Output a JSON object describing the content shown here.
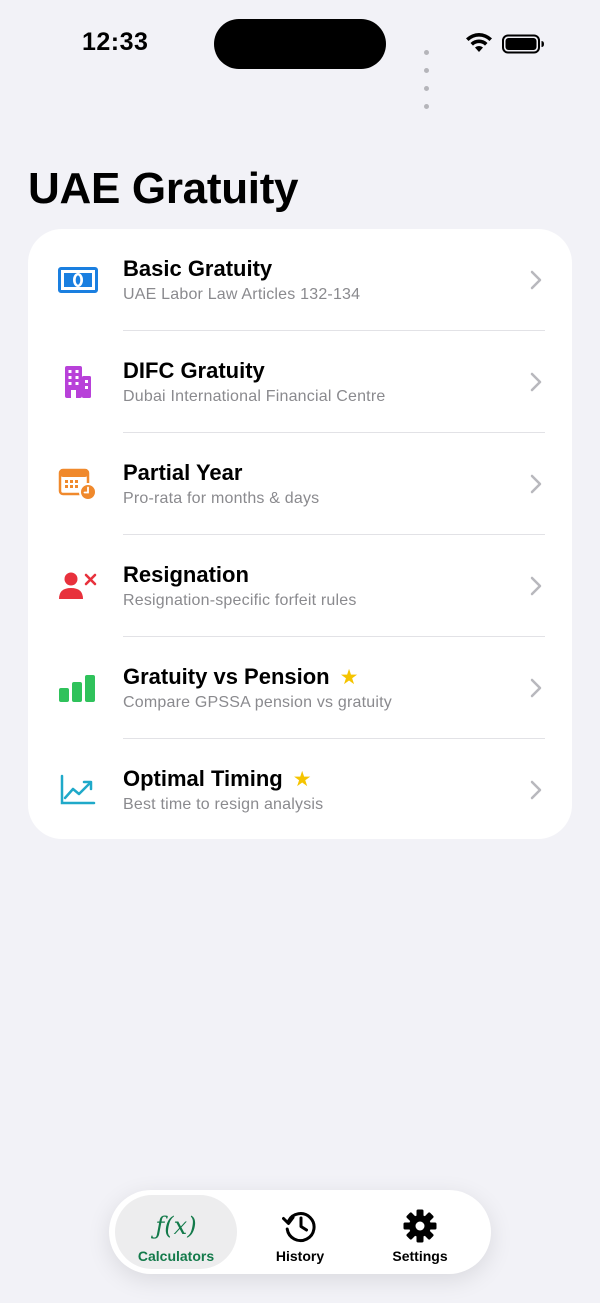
{
  "status_bar": {
    "time": "12:33"
  },
  "header": {
    "title": "UAE Gratuity"
  },
  "calculators": [
    {
      "title": "Basic Gratuity",
      "subtitle": "UAE Labor Law Articles 132-134",
      "icon": "banknote-icon",
      "icon_color": "#1a7fe0",
      "premium": false
    },
    {
      "title": "DIFC Gratuity",
      "subtitle": "Dubai International Financial Centre",
      "icon": "building-icon",
      "icon_color": "#b841d9",
      "premium": false
    },
    {
      "title": "Partial Year",
      "subtitle": "Pro-rata for months & days",
      "icon": "calendar-clock-icon",
      "icon_color": "#f0892c",
      "premium": false
    },
    {
      "title": "Resignation",
      "subtitle": "Resignation-specific forfeit rules",
      "icon": "person-remove-icon",
      "icon_color": "#e8313c",
      "premium": false
    },
    {
      "title": "Gratuity vs Pension",
      "subtitle": "Compare GPSSA pension vs gratuity",
      "icon": "bar-chart-icon",
      "icon_color": "#2fc25b",
      "premium": true
    },
    {
      "title": "Optimal Timing",
      "subtitle": "Best time to resign analysis",
      "icon": "trend-chart-icon",
      "icon_color": "#1fa9c9",
      "premium": true
    }
  ],
  "tab_bar": {
    "tabs": [
      {
        "label": "Calculators",
        "icon": "function-icon",
        "active": true
      },
      {
        "label": "History",
        "icon": "history-icon",
        "active": false
      },
      {
        "label": "Settings",
        "icon": "gear-icon",
        "active": false
      }
    ],
    "fx_glyph": "ƒ(x)"
  },
  "colors": {
    "accent": "#137a4a",
    "background": "#f2f2f7",
    "star": "#f5c400"
  }
}
